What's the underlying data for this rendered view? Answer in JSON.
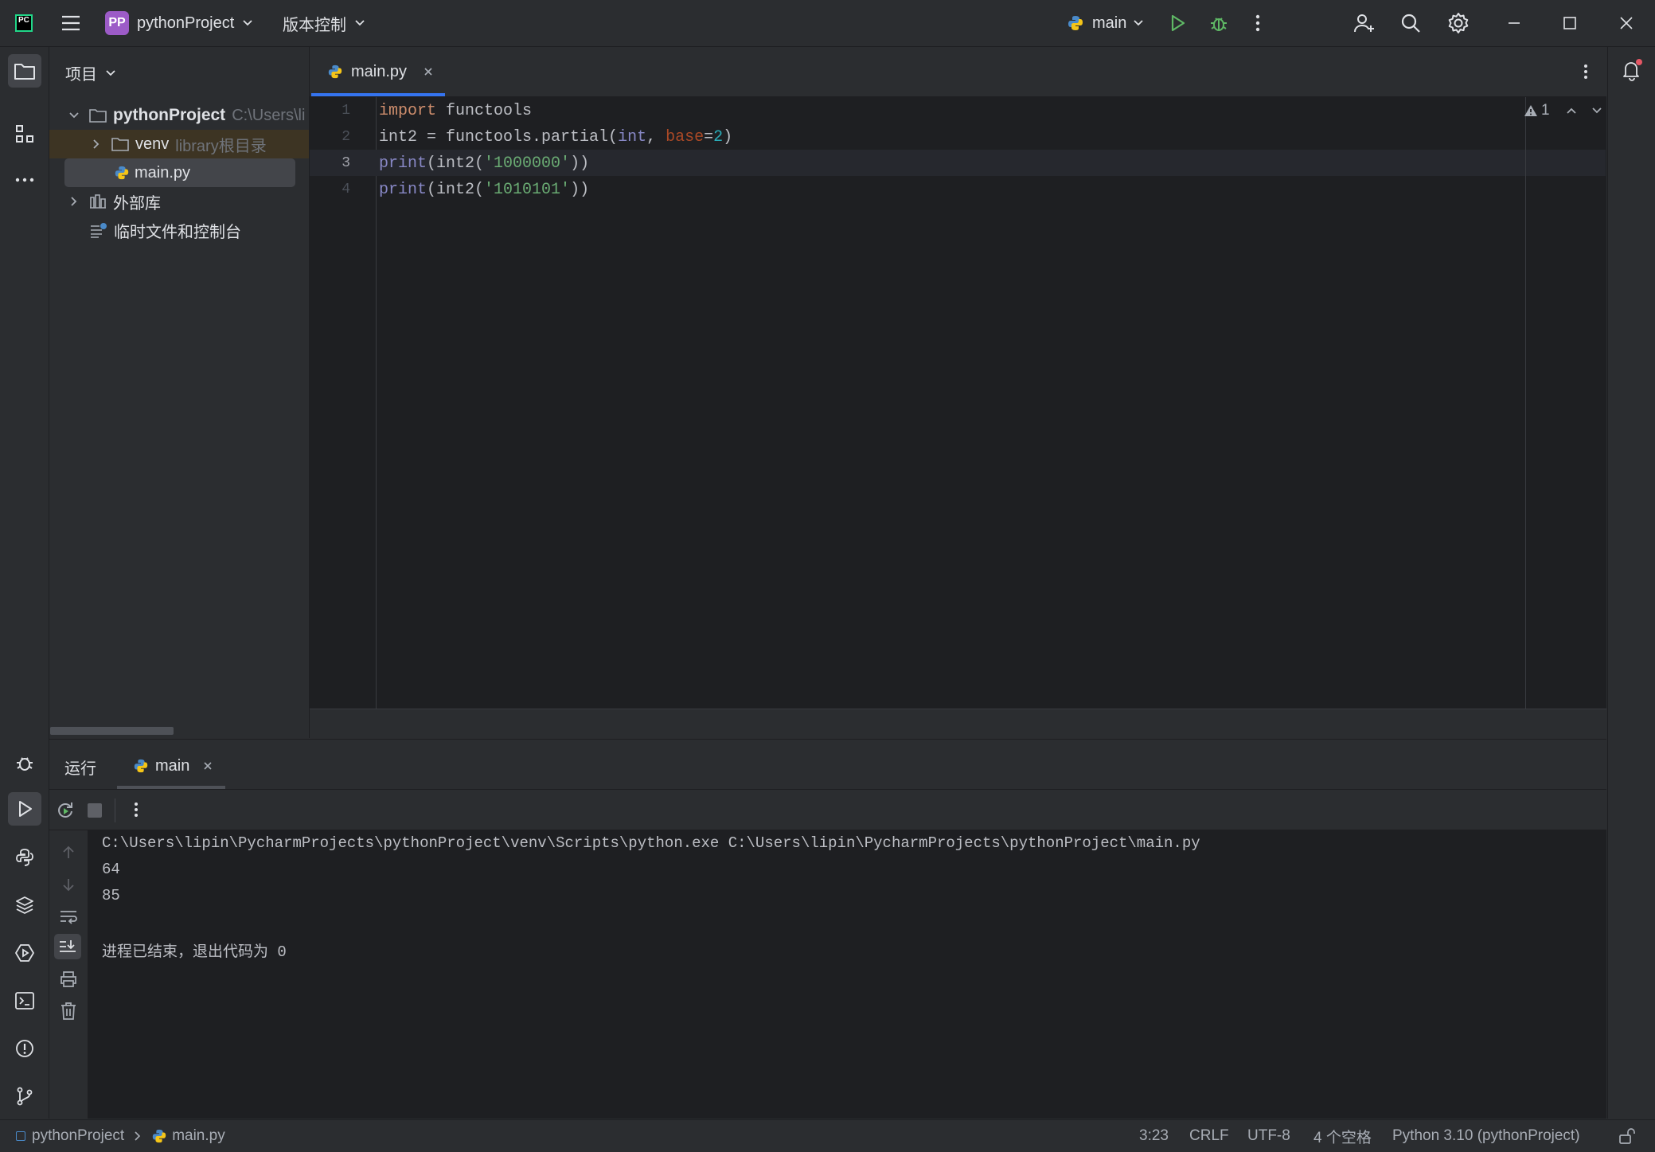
{
  "titlebar": {
    "logo_text": "PC",
    "project_badge": "PP",
    "project_name": "pythonProject",
    "vcs_label": "版本控制",
    "run_config": "main"
  },
  "project_panel": {
    "title": "项目",
    "tree": [
      {
        "label": "pythonProject",
        "hint": "C:\\Users\\li"
      },
      {
        "label": "venv",
        "hint": "library根目录"
      },
      {
        "label": "main.py",
        "hint": ""
      },
      {
        "label": "外部库",
        "hint": ""
      },
      {
        "label": "临时文件和控制台",
        "hint": ""
      }
    ]
  },
  "editor": {
    "tab_label": "main.py",
    "warning_count": "1",
    "line_numbers": [
      "1",
      "2",
      "3",
      "4"
    ],
    "code": {
      "l1_kw": "import",
      "l1_rest": " functools",
      "l2_a": "int2 = functools.partial(",
      "l2_int": "int",
      "l2_b": ", ",
      "l2_param": "base",
      "l2_eq": "=",
      "l2_num": "2",
      "l2_c": ")",
      "l3_print": "print",
      "l3_a": "(int2(",
      "l3_str": "'1000000'",
      "l3_b": "))",
      "l4_print": "print",
      "l4_a": "(int2(",
      "l4_str": "'1010101'",
      "l4_b": "))"
    }
  },
  "run_panel": {
    "title": "运行",
    "tab_label": "main",
    "output": [
      "C:\\Users\\lipin\\PycharmProjects\\pythonProject\\venv\\Scripts\\python.exe C:\\Users\\lipin\\PycharmProjects\\pythonProject\\main.py",
      "64",
      "85",
      "",
      "进程已结束，退出代码为 0"
    ]
  },
  "statusbar": {
    "breadcrumb_project": "pythonProject",
    "breadcrumb_file": "main.py",
    "position": "3:23",
    "line_sep": "CRLF",
    "encoding": "UTF-8",
    "indent": "4 个空格",
    "interpreter": "Python 3.10 (pythonProject)"
  },
  "colors": {
    "accent": "#3574f0",
    "run_green": "#5fb865",
    "editor_bg": "#1e1f22",
    "panel_bg": "#2b2d30"
  }
}
